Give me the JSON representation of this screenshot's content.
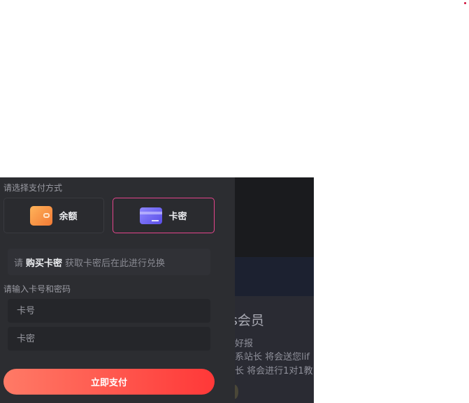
{
  "colors": {
    "accent_border": "#e5458c",
    "pay_gradient_start": "#ff7a66",
    "pay_gradient_end": "#ff3838",
    "panel_bg": "#2c2d31"
  },
  "background_page": {
    "title_fragment": "s会员",
    "lines": [
      "好报",
      "系站长 将会送您lif",
      "长 将会进行1对1教"
    ]
  },
  "payment": {
    "method_label": "请选择支付方式",
    "methods": [
      {
        "label": "余额",
        "icon": "wallet-icon",
        "selected": false
      },
      {
        "label": "卡密",
        "icon": "credit-card-icon",
        "selected": true
      }
    ],
    "notice": {
      "prefix": "请",
      "link": "购买卡密",
      "suffix": "获取卡密后在此进行兑换"
    },
    "input_label": "请输入卡号和密码",
    "card_number_placeholder": "卡号",
    "card_password_placeholder": "卡密",
    "pay_button": "立即支付"
  }
}
